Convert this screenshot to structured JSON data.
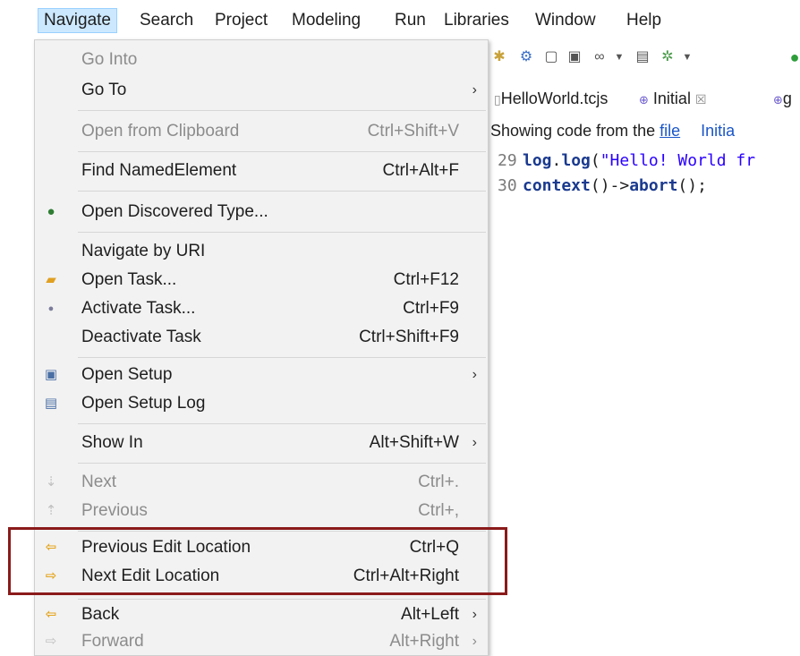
{
  "menubar": {
    "items": [
      "Navigate",
      "Search",
      "Project",
      "Modeling",
      "Run",
      "Libraries",
      "Window",
      "Help"
    ]
  },
  "editor": {
    "tabs": [
      "HelloWorld.tcjs",
      "Initial",
      "g"
    ],
    "info_prefix": "Showing code from the",
    "info_link": "file",
    "info_link2": "Initia",
    "code": [
      {
        "num": "29",
        "fn": "log",
        "call": "log",
        "arg": "\"Hello! World fr"
      },
      {
        "num": "30",
        "text_a": "context",
        "text_b": "()->",
        "text_c": "abort",
        "text_d": "();"
      }
    ]
  },
  "menu": {
    "items": [
      {
        "label": "Go Into",
        "shortcut": "",
        "icon": "",
        "disabled": true,
        "submenu": false
      },
      {
        "label": "Go To",
        "shortcut": "",
        "icon": "",
        "disabled": false,
        "submenu": true
      },
      {
        "label": "Open from Clipboard",
        "shortcut": "Ctrl+Shift+V",
        "icon": "",
        "disabled": true,
        "submenu": false
      },
      {
        "label": "Find NamedElement",
        "shortcut": "Ctrl+Alt+F",
        "icon": "",
        "disabled": false,
        "submenu": false
      },
      {
        "label": "Open Discovered Type...",
        "shortcut": "",
        "icon": "globe-icon",
        "disabled": false,
        "submenu": false
      },
      {
        "label": "Navigate by URI",
        "shortcut": "",
        "icon": "",
        "disabled": false,
        "submenu": false
      },
      {
        "label": "Open Task...",
        "shortcut": "Ctrl+F12",
        "icon": "folder-open-icon",
        "disabled": false,
        "submenu": false
      },
      {
        "label": "Activate Task...",
        "shortcut": "Ctrl+F9",
        "icon": "task-dot-icon",
        "disabled": false,
        "submenu": false
      },
      {
        "label": "Deactivate Task",
        "shortcut": "Ctrl+Shift+F9",
        "icon": "",
        "disabled": false,
        "submenu": false
      },
      {
        "label": "Open Setup",
        "shortcut": "",
        "icon": "setup-icon",
        "disabled": false,
        "submenu": true
      },
      {
        "label": "Open Setup Log",
        "shortcut": "",
        "icon": "setup-log-icon",
        "disabled": false,
        "submenu": false
      },
      {
        "label": "Show In",
        "shortcut": "Alt+Shift+W",
        "icon": "",
        "disabled": false,
        "submenu": true
      },
      {
        "label": "Next",
        "shortcut": "Ctrl+.",
        "icon": "next-annotation-icon",
        "disabled": true,
        "submenu": false
      },
      {
        "label": "Previous",
        "shortcut": "Ctrl+,",
        "icon": "previous-annotation-icon",
        "disabled": true,
        "submenu": false
      },
      {
        "label": "Previous Edit Location",
        "shortcut": "Ctrl+Q",
        "icon": "previous-edit-icon",
        "disabled": false,
        "submenu": false
      },
      {
        "label": "Next Edit Location",
        "shortcut": "Ctrl+Alt+Right",
        "icon": "next-edit-icon",
        "disabled": false,
        "submenu": false
      },
      {
        "label": "Back",
        "shortcut": "Alt+Left",
        "icon": "back-arrow-icon",
        "disabled": false,
        "submenu": true
      },
      {
        "label": "Forward",
        "shortcut": "Alt+Right",
        "icon": "forward-arrow-icon",
        "disabled": true,
        "submenu": true
      }
    ]
  },
  "colors": {
    "highlight_border": "#8b1a1a",
    "menu_bg": "#f2f2f2",
    "active_menu_bg": "#cce8ff"
  }
}
